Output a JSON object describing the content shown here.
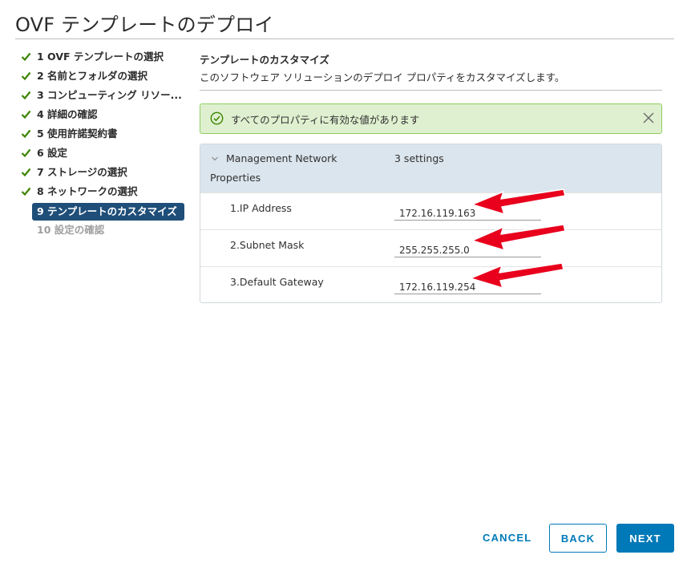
{
  "window": {
    "title": "OVF テンプレートのデプロイ"
  },
  "sidebar": {
    "steps": [
      {
        "label": "1 OVF テンプレートの選択",
        "state": "done"
      },
      {
        "label": "2 名前とフォルダの選択",
        "state": "done"
      },
      {
        "label": "3 コンピューティング リソー...",
        "state": "done"
      },
      {
        "label": "4 詳細の確認",
        "state": "done"
      },
      {
        "label": "5 使用許諾契約書",
        "state": "done"
      },
      {
        "label": "6 設定",
        "state": "done"
      },
      {
        "label": "7 ストレージの選択",
        "state": "done"
      },
      {
        "label": "8 ネットワークの選択",
        "state": "done"
      },
      {
        "label": "9 テンプレートのカスタマイズ",
        "state": "active"
      },
      {
        "label": "10 設定の確認",
        "state": "disabled"
      }
    ]
  },
  "main": {
    "title": "テンプレートのカスタマイズ",
    "description": "このソフトウェア ソリューションのデプロイ プロパティをカスタマイズします。",
    "alert": {
      "message": "すべてのプロパティに有効な値があります"
    },
    "group": {
      "name_line1": "Management Network",
      "name_line2": "Properties",
      "count": "3 settings",
      "rows": [
        {
          "label": "1.IP Address",
          "value": "172.16.119.163"
        },
        {
          "label": "2.Subnet Mask",
          "value": "255.255.255.0"
        },
        {
          "label": "3.Default Gateway",
          "value": "172.16.119.254"
        }
      ]
    }
  },
  "footer": {
    "cancel_label": "CANCEL",
    "back_label": "BACK",
    "next_label": "NEXT"
  },
  "colors": {
    "primary": "#0079b8",
    "active_step": "#1f4e79",
    "success_bg": "#dff0d0",
    "success_border": "#8fcf5e",
    "annotation_arrow": "#e8001c"
  },
  "icons": {
    "step_done": "check-icon",
    "alert": "success-circle-icon",
    "alert_close": "close-icon",
    "group_toggle": "chevron-down-icon",
    "annotation": "red-arrow-icon"
  }
}
